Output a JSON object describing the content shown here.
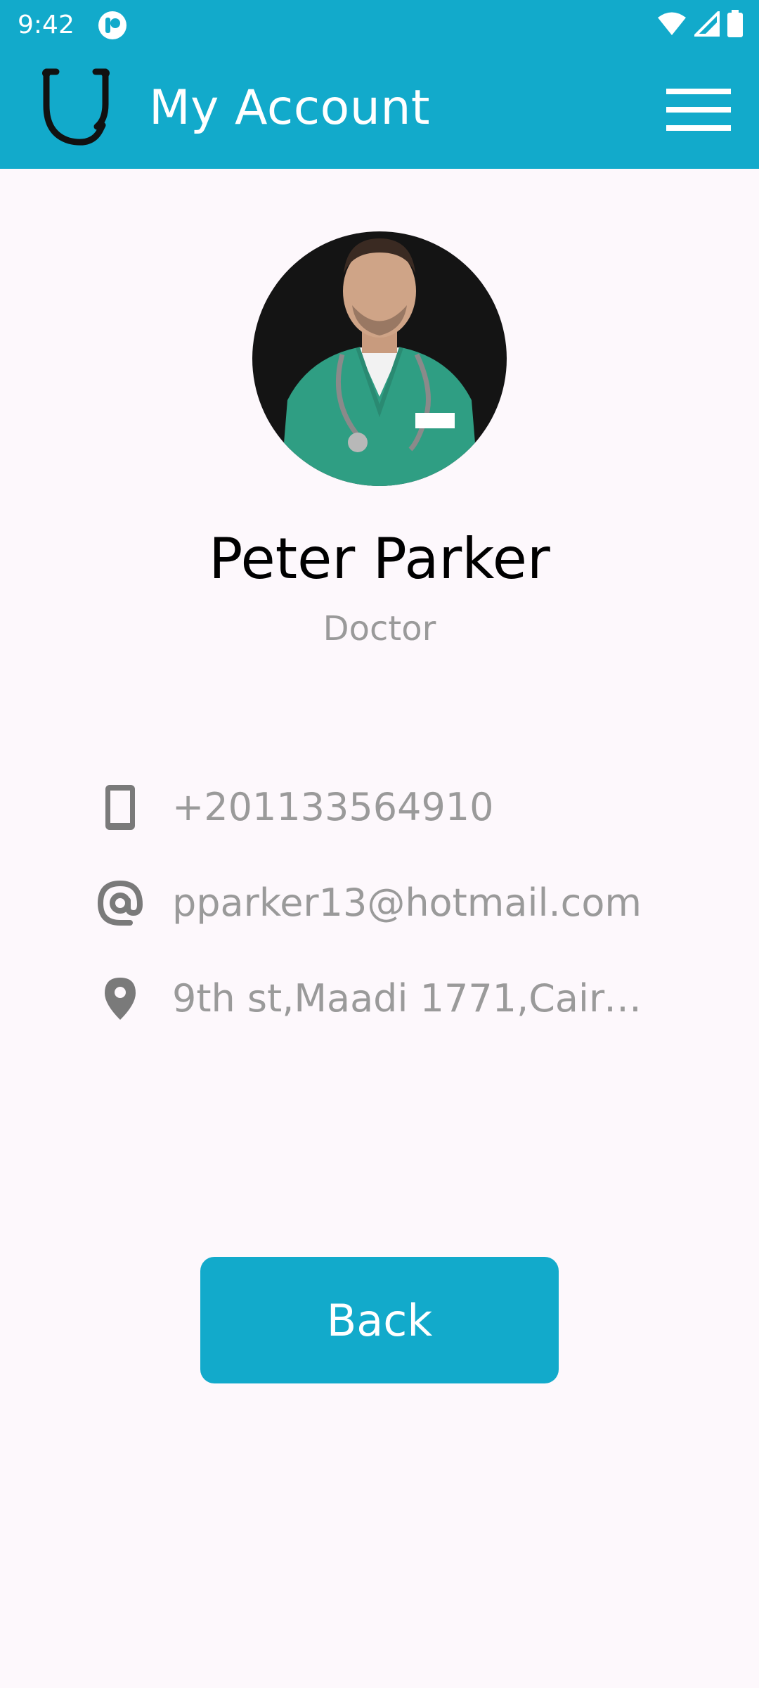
{
  "status_bar": {
    "time": "9:42",
    "icons": [
      "app-notification-icon",
      "wifi-icon",
      "cellular-icon",
      "battery-icon"
    ]
  },
  "appbar": {
    "title": "My Account",
    "logo_icon": "stethoscope-icon",
    "menu_icon": "hamburger-menu-icon",
    "background_color": "#12aacb"
  },
  "profile": {
    "avatar_alt": "profile photo",
    "name": "Peter Parker",
    "role": "Doctor"
  },
  "contact": {
    "phone": "+201133564910",
    "email": "pparker13@hotmail.com",
    "address": "9th st,Maadi 1771,Cairo…"
  },
  "actions": {
    "back_label": "Back"
  },
  "colors": {
    "accent": "#12aacb",
    "muted_text": "#9a9a9a",
    "icon_gray": "#7a7a7a",
    "background": "#fdf8fc"
  }
}
